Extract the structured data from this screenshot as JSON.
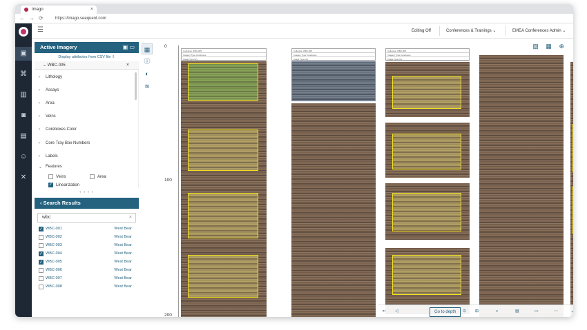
{
  "browser": {
    "tab_title": "Imago",
    "tab_close": "×",
    "url": "https://imago.seequent.com",
    "back": "←",
    "forward": "→",
    "reload": "⟳"
  },
  "topbar": {
    "menu_icon": "☰",
    "editing": "Editing Off",
    "workspace": "Conferences & Trainings",
    "user": "EMEA Conferences Admin"
  },
  "left_rail": {
    "icons": [
      "collection-icon",
      "hierarchy-icon",
      "chart-icon",
      "camera-icon",
      "report-icon",
      "users-icon",
      "tools-icon"
    ],
    "glyphs": [
      "▣",
      "⌘",
      "▥",
      "◙",
      "▤",
      "☺",
      "✕"
    ]
  },
  "active_imagery": {
    "title": "Active Imagery",
    "save_icon": "▣",
    "folder_icon": "▭",
    "csv_link": "Display attributes from CSV file",
    "csv_icon": "⇩",
    "dataset": "WBC-005",
    "dataset_close": "×",
    "tree_items": [
      {
        "label": "Lithology",
        "chev": "›"
      },
      {
        "label": "Assays",
        "chev": "›"
      },
      {
        "label": "Area",
        "chev": "›"
      },
      {
        "label": "Veins",
        "chev": "›"
      },
      {
        "label": "Coreboxes Color",
        "chev": "›"
      },
      {
        "label": "Core Tray Box Numbers",
        "chev": "›"
      },
      {
        "label": "Labels",
        "chev": "›"
      },
      {
        "label": "Features",
        "chev": "⌄"
      }
    ],
    "features": {
      "veins": "Veins",
      "area": "Area",
      "linearization": "Linearization"
    },
    "handle": "• • • •"
  },
  "search": {
    "title": "Search Results",
    "back_glyph": "‹",
    "query": "wbc",
    "clear": "×",
    "results": [
      {
        "id": "WBC-001",
        "loc": "West Bear",
        "checked": true
      },
      {
        "id": "WBC-002",
        "loc": "West Bear",
        "checked": false
      },
      {
        "id": "WBC-003",
        "loc": "West Bear",
        "checked": false
      },
      {
        "id": "WBC-004",
        "loc": "West Bear",
        "checked": true
      },
      {
        "id": "WBC-005",
        "loc": "West Bear",
        "checked": true
      },
      {
        "id": "WBC-006",
        "loc": "West Bear",
        "checked": false
      },
      {
        "id": "WBC-007",
        "loc": "West Bear",
        "checked": false
      },
      {
        "id": "WBC-008",
        "loc": "West Bear",
        "checked": false
      }
    ]
  },
  "tools": {
    "glyphs": [
      "▦",
      "ⓘ",
      "◐",
      "≋"
    ],
    "names": [
      "table-view-icon",
      "info-icon",
      "palette-icon",
      "layers-icon"
    ]
  },
  "viewer": {
    "y_ticks": [
      "0",
      "100",
      "200"
    ],
    "view_icons": [
      "▨",
      "▦",
      "⊕"
    ],
    "bottom": {
      "go_to_depth": "Go to depth",
      "glyphs": [
        "⇤",
        "◁",
        "⊙",
        "⊞",
        "⌕",
        "▤",
        "▭",
        "⋯",
        "⤢"
      ]
    },
    "header_rows": [
      "Collection  WBC-005",
      "Imagery Type  Coreboxes",
      "Image Type  Dry"
    ]
  }
}
